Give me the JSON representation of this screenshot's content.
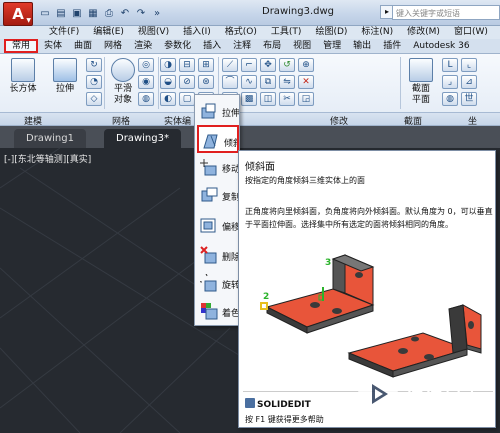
{
  "window": {
    "title": "Drawing3.dwg",
    "search_placeholder": "键入关键字或短语"
  },
  "quick_access": [
    "new-icon",
    "open-icon",
    "save-icon",
    "saveas-icon",
    "print-icon",
    "undo-icon",
    "redo-icon",
    "more-icon"
  ],
  "menu": [
    "文件(F)",
    "编辑(E)",
    "视图(V)",
    "插入(I)",
    "格式(O)",
    "工具(T)",
    "绘图(D)",
    "标注(N)",
    "修改(M)",
    "窗口(W)"
  ],
  "ribbon_tabs": [
    "常用",
    "实体",
    "曲面",
    "网格",
    "渲染",
    "参数化",
    "插入",
    "注释",
    "布局",
    "视图",
    "管理",
    "输出",
    "插件",
    "Autodesk 36"
  ],
  "ribbon": {
    "box_label": "长方体",
    "extrude_label": "拉伸",
    "smooth_label": "平滑",
    "smooth_label2": "对象",
    "section_plane_label": "截面",
    "section_plane_label2": "平面",
    "panels": {
      "modeling": "建模",
      "mesh": "网格",
      "solid_edit": "实体编",
      "modify": "修改",
      "section": "截面",
      "coordinates": "坐"
    },
    "ucs_label": "世"
  },
  "doc_tabs": [
    "Drawing1",
    "Drawing3*"
  ],
  "viewport_label": "[-][东北等轴测][真实]",
  "dropdown": [
    {
      "label": "拉伸面",
      "icon": "extrude-face-icon"
    },
    {
      "label": "倾斜面",
      "icon": "taper-face-icon"
    },
    {
      "label": "移动",
      "icon": "move-face-icon"
    },
    {
      "label": "复制",
      "icon": "copy-face-icon"
    },
    {
      "label": "偏移",
      "icon": "offset-face-icon"
    },
    {
      "label": "删除",
      "icon": "delete-face-icon"
    },
    {
      "label": "旋转",
      "icon": "rotate-face-icon"
    },
    {
      "label": "着色",
      "icon": "color-face-icon"
    }
  ],
  "tooltip": {
    "title": "倾斜面",
    "subtitle": "按指定的角度倾斜三维实体上的面",
    "body": "正角度将向里倾斜面，负角度将向外倾斜面。默认角度为 0，可以垂直于平面拉伸面。选择集中所有选定的面将倾斜相同的角度。",
    "illustration_labels": [
      "3",
      "2"
    ],
    "command": "SOLIDEDIT",
    "help": "按 F1 键获得更多帮助"
  },
  "watermark": {
    "text": "溜溜自学",
    "url": "ZIXUE.3D66.COM"
  },
  "colors": {
    "accent_red": "#e01f1f",
    "face_orange": "#e8553a",
    "viewport_bg": "#262a30"
  }
}
